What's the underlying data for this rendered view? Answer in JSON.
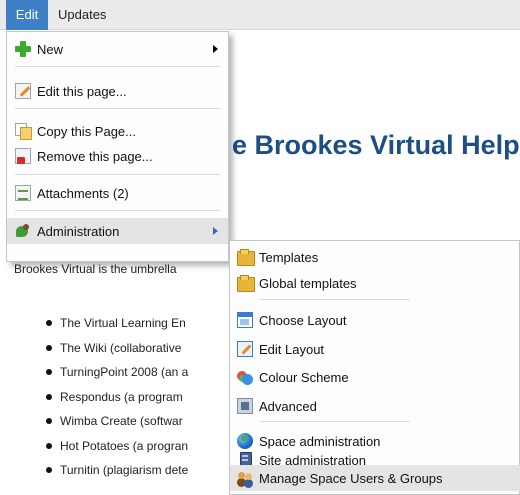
{
  "menubar": {
    "edit_label": "Edit",
    "updates_label": "Updates"
  },
  "page": {
    "title": "e Brookes Virtual Help",
    "intro": "Brookes Virtual is the umbrella",
    "bullets": [
      "The Virtual Learning En",
      "The Wiki (collaborative",
      "TurningPoint 2008 (an a",
      "Respondus (a program",
      "Wimba Create (softwar",
      "Hot Potatoes (a progran",
      "Turnitin (plagiarism dete"
    ]
  },
  "edit_menu": {
    "items": [
      {
        "label": "New",
        "icon": "add-icon"
      },
      {
        "label": "Edit this page...",
        "icon": "edit-page-icon"
      },
      {
        "label": "Copy this Page...",
        "icon": "copy-page-icon"
      },
      {
        "label": "Remove this page...",
        "icon": "remove-page-icon"
      },
      {
        "label": "Attachments (2)",
        "icon": "attachment-icon"
      },
      {
        "label": "Administration",
        "icon": "wrench-icon"
      }
    ]
  },
  "admin_menu": {
    "items": [
      {
        "label": "Templates",
        "icon": "folder-icon"
      },
      {
        "label": "Global templates",
        "icon": "folder-icon"
      },
      {
        "label": "Choose Layout",
        "icon": "layout-icon"
      },
      {
        "label": "Edit Layout",
        "icon": "edit-layout-icon"
      },
      {
        "label": "Colour Scheme",
        "icon": "palette-icon"
      },
      {
        "label": "Advanced",
        "icon": "advanced-icon"
      },
      {
        "label": "Space administration",
        "icon": "globe-icon"
      },
      {
        "label": "Site administration",
        "icon": "server-icon"
      },
      {
        "label": "Manage Space Users & Groups",
        "icon": "users-icon"
      }
    ]
  },
  "colors": {
    "menubar_bg": "#ebebeb",
    "active_menu": "#3d80c6",
    "title_blue": "#1c4f85",
    "hover_row": "#e4e4e4"
  }
}
